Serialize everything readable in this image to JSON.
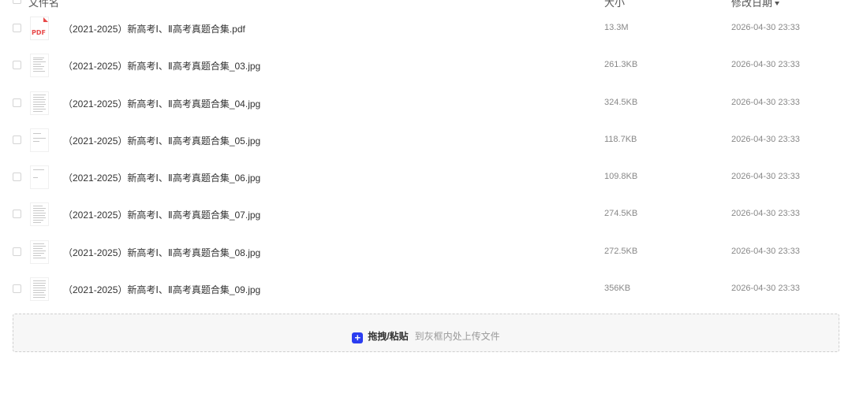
{
  "header": {
    "name_label": "文件名",
    "size_label": "大小",
    "date_label": "修改日期"
  },
  "files": [
    {
      "name": "（2021-2025）新高考Ⅰ、Ⅱ高考真题合集.pdf",
      "size": "13.3M",
      "date": "2026-04-30 23:33",
      "type": "pdf"
    },
    {
      "name": "（2021-2025）新高考Ⅰ、Ⅱ高考真题合集_03.jpg",
      "size": "261.3KB",
      "date": "2026-04-30 23:33",
      "type": "jpg"
    },
    {
      "name": "（2021-2025）新高考Ⅰ、Ⅱ高考真题合集_04.jpg",
      "size": "324.5KB",
      "date": "2026-04-30 23:33",
      "type": "jpg"
    },
    {
      "name": "（2021-2025）新高考Ⅰ、Ⅱ高考真题合集_05.jpg",
      "size": "118.7KB",
      "date": "2026-04-30 23:33",
      "type": "jpg"
    },
    {
      "name": "（2021-2025）新高考Ⅰ、Ⅱ高考真题合集_06.jpg",
      "size": "109.8KB",
      "date": "2026-04-30 23:33",
      "type": "jpg"
    },
    {
      "name": "（2021-2025）新高考Ⅰ、Ⅱ高考真题合集_07.jpg",
      "size": "274.5KB",
      "date": "2026-04-30 23:33",
      "type": "jpg"
    },
    {
      "name": "（2021-2025）新高考Ⅰ、Ⅱ高考真题合集_08.jpg",
      "size": "272.5KB",
      "date": "2026-04-30 23:33",
      "type": "jpg"
    },
    {
      "name": "（2021-2025）新高考Ⅰ、Ⅱ高考真题合集_09.jpg",
      "size": "356KB",
      "date": "2026-04-30 23:33",
      "type": "jpg"
    }
  ],
  "upload": {
    "action_label": "拖拽/粘贴",
    "hint": "到灰框内处上传文件",
    "icon": "plus-icon",
    "accent": "#2b3df0"
  },
  "colors": {
    "pdf_red": "#e84a4a"
  }
}
